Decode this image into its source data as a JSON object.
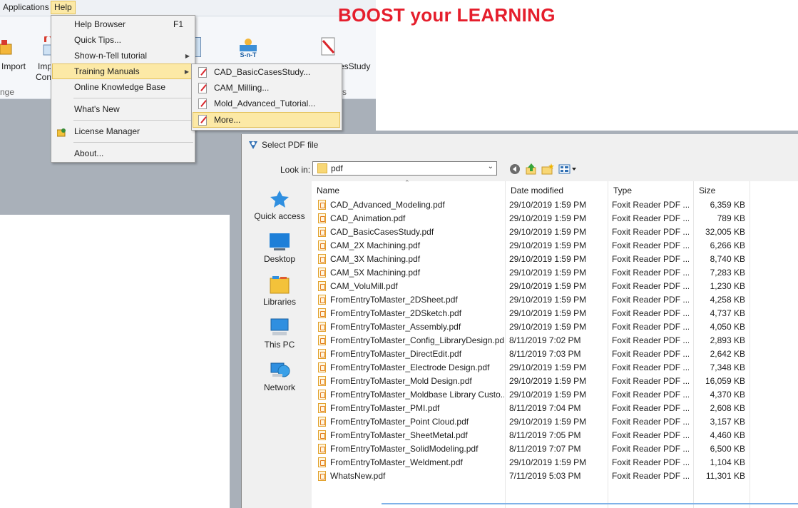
{
  "menubar": {
    "applications": "Applications",
    "help": "Help"
  },
  "banner": "BOOST your LEARNING",
  "ribbon": {
    "import": "Import",
    "imp_partial": "Imp",
    "con_partial": "Con",
    "nge_partial": "nge",
    "s_partial": "s",
    "snt_icon_text": "S-n-T",
    "casestudy_partial": "esStudy"
  },
  "help_menu": {
    "items": [
      {
        "label": "Help Browser",
        "shortcut": "F1"
      },
      {
        "label": "Quick Tips..."
      },
      {
        "label": "Show-n-Tell tutorial"
      },
      {
        "label": "Training Manuals"
      },
      {
        "label": "Online Knowledge Base"
      },
      {
        "label": "What's New"
      },
      {
        "label": "License Manager"
      },
      {
        "label": "About..."
      }
    ]
  },
  "submenu": {
    "items": [
      {
        "label": "CAD_BasicCasesStudy..."
      },
      {
        "label": "CAM_Milling..."
      },
      {
        "label": "Mold_Advanced_Tutorial..."
      },
      {
        "label": "More..."
      }
    ]
  },
  "dialog": {
    "title": "Select PDF file",
    "look_in_label": "Look in:",
    "look_in_value": "pdf",
    "places": [
      "Quick access",
      "Desktop",
      "Libraries",
      "This PC",
      "Network"
    ],
    "columns": {
      "name": "Name",
      "date": "Date modified",
      "type": "Type",
      "size": "Size"
    },
    "files": [
      {
        "name": "CAD_Advanced_Modeling.pdf",
        "date": "29/10/2019 1:59 PM",
        "type": "Foxit Reader PDF ...",
        "size": "6,359 KB"
      },
      {
        "name": "CAD_Animation.pdf",
        "date": "29/10/2019 1:59 PM",
        "type": "Foxit Reader PDF ...",
        "size": "789 KB"
      },
      {
        "name": "CAD_BasicCasesStudy.pdf",
        "date": "29/10/2019 1:59 PM",
        "type": "Foxit Reader PDF ...",
        "size": "32,005 KB"
      },
      {
        "name": "CAM_2X Machining.pdf",
        "date": "29/10/2019 1:59 PM",
        "type": "Foxit Reader PDF ...",
        "size": "6,266 KB"
      },
      {
        "name": "CAM_3X Machining.pdf",
        "date": "29/10/2019 1:59 PM",
        "type": "Foxit Reader PDF ...",
        "size": "8,740 KB"
      },
      {
        "name": "CAM_5X Machining.pdf",
        "date": "29/10/2019 1:59 PM",
        "type": "Foxit Reader PDF ...",
        "size": "7,283 KB"
      },
      {
        "name": "CAM_VoluMill.pdf",
        "date": "29/10/2019 1:59 PM",
        "type": "Foxit Reader PDF ...",
        "size": "1,230 KB"
      },
      {
        "name": "FromEntryToMaster_2DSheet.pdf",
        "date": "29/10/2019 1:59 PM",
        "type": "Foxit Reader PDF ...",
        "size": "4,258 KB"
      },
      {
        "name": "FromEntryToMaster_2DSketch.pdf",
        "date": "29/10/2019 1:59 PM",
        "type": "Foxit Reader PDF ...",
        "size": "4,737 KB"
      },
      {
        "name": "FromEntryToMaster_Assembly.pdf",
        "date": "29/10/2019 1:59 PM",
        "type": "Foxit Reader PDF ...",
        "size": "4,050 KB"
      },
      {
        "name": "FromEntryToMaster_Config_LibraryDesign.pdf",
        "date": "8/11/2019 7:02 PM",
        "type": "Foxit Reader PDF ...",
        "size": "2,893 KB"
      },
      {
        "name": "FromEntryToMaster_DirectEdit.pdf",
        "date": "8/11/2019 7:03 PM",
        "type": "Foxit Reader PDF ...",
        "size": "2,642 KB"
      },
      {
        "name": "FromEntryToMaster_Electrode Design.pdf",
        "date": "29/10/2019 1:59 PM",
        "type": "Foxit Reader PDF ...",
        "size": "7,348 KB"
      },
      {
        "name": "FromEntryToMaster_Mold Design.pdf",
        "date": "29/10/2019 1:59 PM",
        "type": "Foxit Reader PDF ...",
        "size": "16,059 KB"
      },
      {
        "name": "FromEntryToMaster_Moldbase Library Custo...",
        "date": "29/10/2019 1:59 PM",
        "type": "Foxit Reader PDF ...",
        "size": "4,370 KB"
      },
      {
        "name": "FromEntryToMaster_PMI.pdf",
        "date": "8/11/2019 7:04 PM",
        "type": "Foxit Reader PDF ...",
        "size": "2,608 KB"
      },
      {
        "name": "FromEntryToMaster_Point Cloud.pdf",
        "date": "29/10/2019 1:59 PM",
        "type": "Foxit Reader PDF ...",
        "size": "3,157 KB"
      },
      {
        "name": "FromEntryToMaster_SheetMetal.pdf",
        "date": "8/11/2019 7:05 PM",
        "type": "Foxit Reader PDF ...",
        "size": "4,460 KB"
      },
      {
        "name": "FromEntryToMaster_SolidModeling.pdf",
        "date": "8/11/2019 7:07 PM",
        "type": "Foxit Reader PDF ...",
        "size": "6,500 KB"
      },
      {
        "name": "FromEntryToMaster_Weldment.pdf",
        "date": "29/10/2019 1:59 PM",
        "type": "Foxit Reader PDF ...",
        "size": "1,104 KB"
      },
      {
        "name": "WhatsNew.pdf",
        "date": "7/11/2019 5:03 PM",
        "type": "Foxit Reader PDF ...",
        "size": "11,301 KB"
      }
    ]
  },
  "colors": {
    "banner": "#e51e2c",
    "highlight": "#fce9a6",
    "highlight_border": "#e3c15b"
  },
  "icons": [
    "folder-icon",
    "back-icon",
    "up-folder-icon",
    "new-folder-icon",
    "view-menu-icon",
    "star-icon",
    "desktop-icon",
    "libraries-icon",
    "this-pc-icon",
    "network-icon",
    "pdf-file-icon",
    "license-icon"
  ]
}
